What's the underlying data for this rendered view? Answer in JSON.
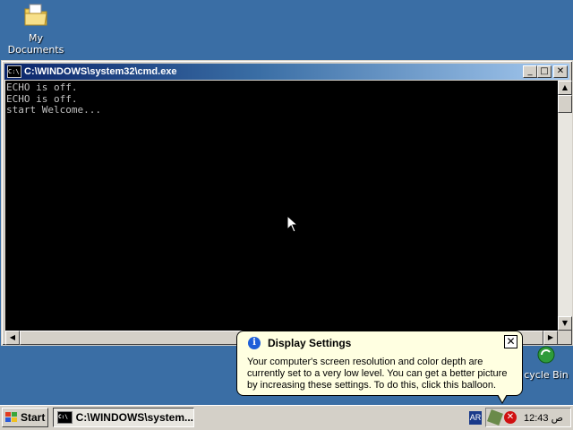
{
  "desktop": {
    "my_documents_label": "My Documents",
    "recycle_bin_label": "cycle Bin"
  },
  "window": {
    "title": "C:\\WINDOWS\\system32\\cmd.exe",
    "minimize_glyph": "_",
    "maximize_glyph": "□",
    "close_glyph": "✕"
  },
  "console": {
    "output": "ECHO is off.\nECHO is off.\nstart Welcome..."
  },
  "balloon": {
    "title": "Display Settings",
    "text": "Your computer's screen resolution and color depth are currently set to a very low level. You can get a better picture by increasing these settings. To do this, click this balloon.",
    "close_glyph": "✕",
    "info_glyph": "i"
  },
  "taskbar": {
    "start_label": "Start",
    "task_label": "C:\\WINDOWS\\system...",
    "language": "AR",
    "clock": "12:43 ص"
  },
  "colors": {
    "desktop": "#3a6ea5",
    "titlebar_start": "#0a246a",
    "balloon_bg": "#ffffe1"
  }
}
